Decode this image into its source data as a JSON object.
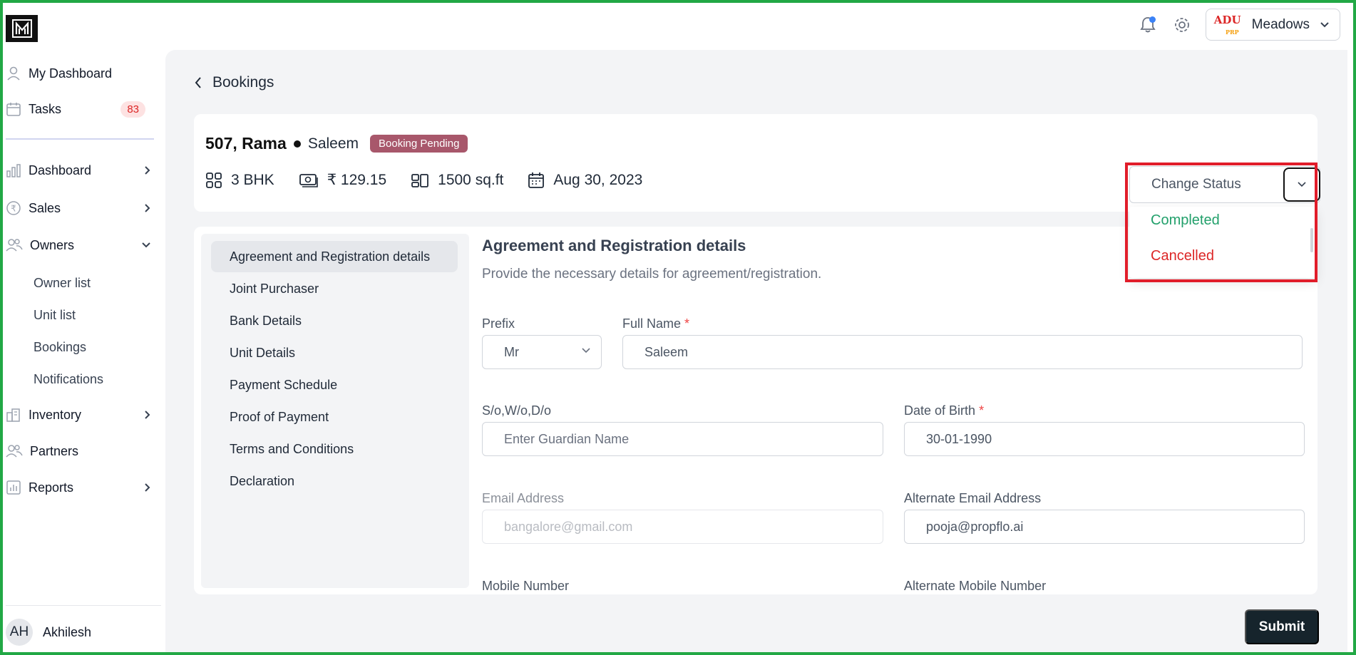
{
  "topbar": {
    "project_name": "Meadows",
    "project_logo_text": "ADU",
    "project_logo_sub": "PRP",
    "has_notification": true
  },
  "sidebar": {
    "primary": [
      {
        "label": "My Dashboard",
        "icon": "user-icon"
      },
      {
        "label": "Tasks",
        "icon": "calendar-icon",
        "badge": "83"
      }
    ],
    "sections": [
      {
        "label": "Dashboard",
        "icon": "bar-chart-icon",
        "chevron": "right"
      },
      {
        "label": "Sales",
        "icon": "rupee-icon",
        "chevron": "right"
      },
      {
        "label": "Owners",
        "icon": "users-icon",
        "chevron": "down"
      },
      {
        "label": "Inventory",
        "icon": "building-icon",
        "chevron": "right"
      },
      {
        "label": "Partners",
        "icon": "users-icon"
      },
      {
        "label": "Reports",
        "icon": "report-icon",
        "chevron": "right"
      }
    ],
    "owners_sub": [
      "Owner list",
      "Unit list",
      "Bookings",
      "Notifications"
    ],
    "user": {
      "initials": "AH",
      "name": "Akhilesh"
    }
  },
  "breadcrumb": {
    "label": "Bookings"
  },
  "booking": {
    "unit": "507, Rama",
    "owner": "Saleem",
    "status": "Booking Pending",
    "status_color": "#a8576b",
    "meta": {
      "config": "3 BHK",
      "price": "₹ 129.15",
      "area": "1500 sq.ft",
      "date": "Aug 30, 2023"
    }
  },
  "status_dropdown": {
    "label": "Change Status",
    "options": [
      {
        "label": "Completed",
        "color": "#22a06b"
      },
      {
        "label": "Cancelled",
        "color": "#dc2626"
      }
    ]
  },
  "steps": [
    "Agreement and Registration details",
    "Joint Purchaser",
    "Bank Details",
    "Unit Details",
    "Payment Schedule",
    "Proof of Payment",
    "Terms and Conditions",
    "Declaration"
  ],
  "form": {
    "title": "Agreement and Registration details",
    "subtitle": "Provide the necessary details for agreement/registration.",
    "prefix": {
      "label": "Prefix",
      "value": "Mr"
    },
    "full_name": {
      "label": "Full Name",
      "value": "Saleem"
    },
    "guardian": {
      "label": "S/o,W/o,D/o",
      "placeholder": "Enter Guardian Name"
    },
    "dob": {
      "label": "Date of Birth",
      "value": "30-01-1990"
    },
    "email": {
      "label": "Email Address",
      "value": "bangalore@gmail.com"
    },
    "alt_email": {
      "label": "Alternate Email Address",
      "value": "pooja@propflo.ai"
    },
    "mobile": {
      "label": "Mobile Number"
    },
    "alt_mobile": {
      "label": "Alternate Mobile Number"
    },
    "required_mark": "*"
  },
  "actions": {
    "submit": "Submit"
  },
  "colors": {
    "frame": "#22a845",
    "highlight": "#e11d2a",
    "submit_bg": "#16242c"
  }
}
